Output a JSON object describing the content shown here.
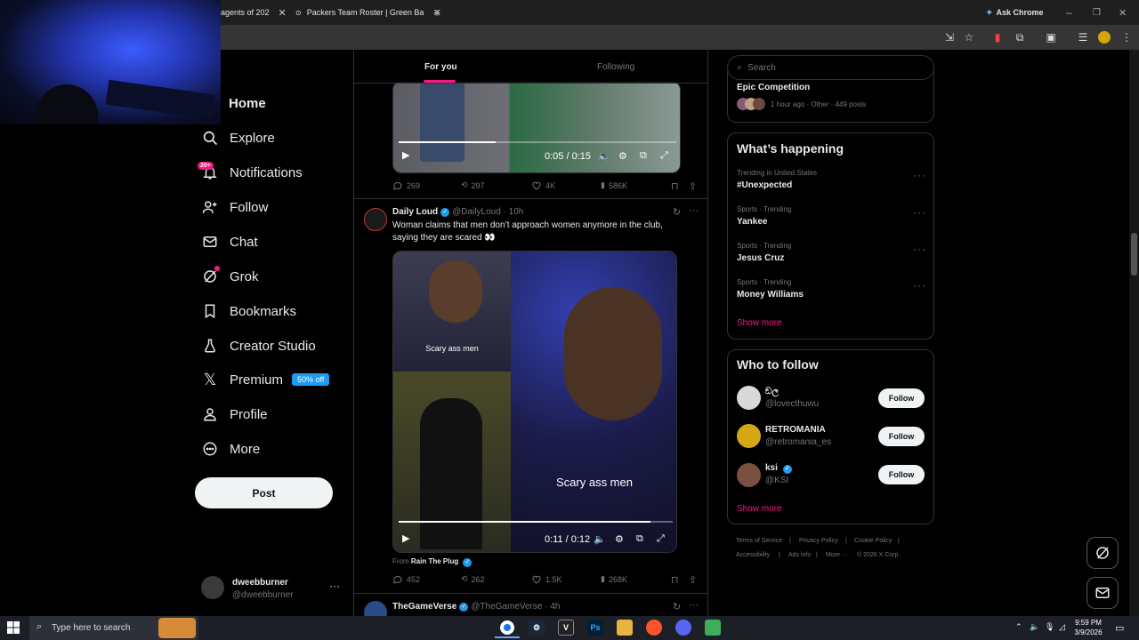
{
  "browser": {
    "tabs": [
      {
        "title": "agents of 202"
      },
      {
        "title": "Packers Team Roster | Green Ba"
      }
    ],
    "ask_chrome": "Ask Chrome"
  },
  "nav": {
    "items": [
      {
        "label": "Home"
      },
      {
        "label": "Explore"
      },
      {
        "label": "Notifications"
      },
      {
        "label": "Follow"
      },
      {
        "label": "Chat"
      },
      {
        "label": "Grok"
      },
      {
        "label": "Bookmarks"
      },
      {
        "label": "Creator Studio"
      },
      {
        "label": "Premium"
      },
      {
        "label": "Profile"
      },
      {
        "label": "More"
      }
    ],
    "notifications_badge": "20+",
    "premium_promo": "50% off",
    "post_label": "Post",
    "account": {
      "name": "dweebburner",
      "handle": "@dweebburner"
    }
  },
  "feed": {
    "tabs": {
      "for_you": "For you",
      "following": "Following"
    },
    "tweet1": {
      "video_time": "0:05 / 0:15",
      "progress": 0.35,
      "replies": "269",
      "reposts": "297",
      "likes": "4K",
      "views": "586K"
    },
    "tweet2": {
      "author": "Daily Loud",
      "handle": "@DailyLoud",
      "time": "10h",
      "text": "Woman claims that men don’t approach women anymore in the club, saying they are scared 👀",
      "caption_small": "Scary ass men",
      "caption_large": "Scary ass men",
      "video_time": "0:11 / 0:12",
      "progress": 0.92,
      "from_prefix": "From",
      "from_name": "Rain The Plug",
      "replies": "452",
      "reposts": "262",
      "likes": "1.5K",
      "views": "268K"
    },
    "tweet3": {
      "author": "TheGameVerse",
      "handle": "@TheGameVerse",
      "time": "4h"
    }
  },
  "sidebar": {
    "search_placeholder": "Search",
    "event": {
      "title": "Epic Competition",
      "meta": "1 hour ago · Other · 449 posts"
    },
    "whats_happening": {
      "title": "What’s happening",
      "trends": [
        {
          "meta": "Trending in United States",
          "name": "#Unexpected"
        },
        {
          "meta": "Sports · Trending",
          "name": "Yankee"
        },
        {
          "meta": "Sports · Trending",
          "name": "Jesus Cruz"
        },
        {
          "meta": "Sports · Trending",
          "name": "Money Williams"
        }
      ],
      "show_more": "Show more"
    },
    "who_to_follow": {
      "title": "Who to follow",
      "accounts": [
        {
          "name": "ඞල",
          "handle": "@lovecthuwu",
          "button": "Follow"
        },
        {
          "name": "RETROMANIA",
          "handle": "@retromania_es",
          "button": "Follow"
        },
        {
          "name": "ksi",
          "handle": "@KSI",
          "button": "Follow"
        }
      ],
      "show_more": "Show more"
    },
    "footer": {
      "links": [
        "Terms of Service",
        "Privacy Policy",
        "Cookie Policy",
        "Accessibility",
        "Ads info",
        "More ···",
        "© 2026 X Corp."
      ]
    }
  },
  "taskbar": {
    "search_placeholder": "Type here to search",
    "time": "9:59 PM",
    "date": "3/9/2026"
  },
  "colors": {
    "accent": "#f91880",
    "verified": "#1d9bf0",
    "background": "#000000"
  }
}
